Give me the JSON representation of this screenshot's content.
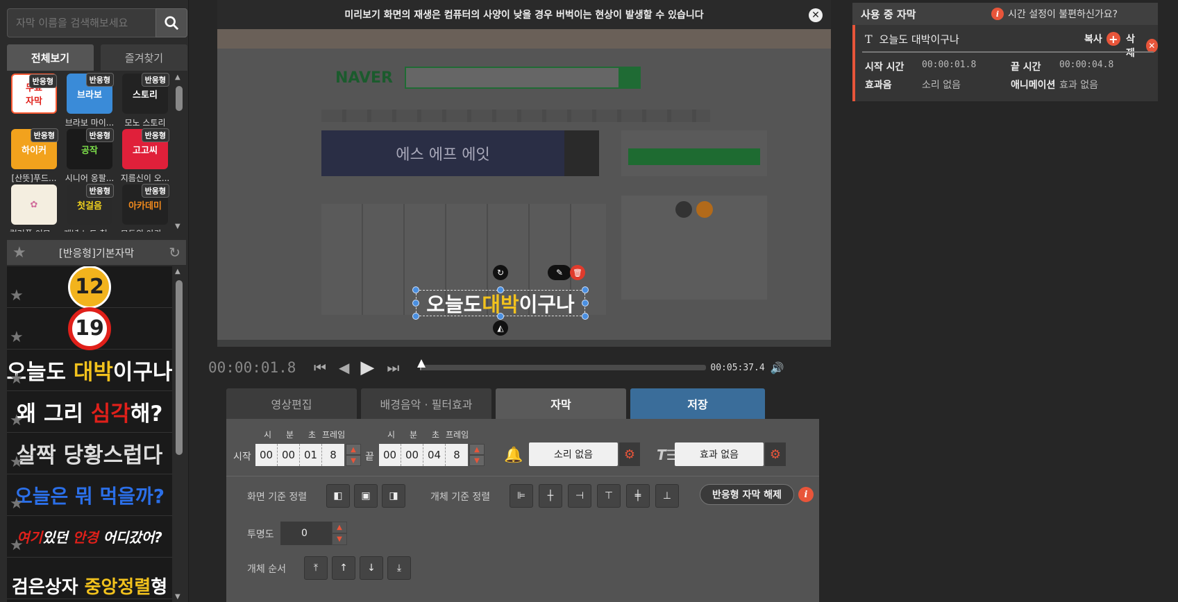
{
  "left": {
    "search_placeholder": "자막 이름을 검색해보세요",
    "tabs": [
      "전체보기",
      "즐겨찾기"
    ],
    "thumbs": [
      {
        "tag": "반응형",
        "caption": "",
        "art": "무료\n자막",
        "bg": "#ffffff",
        "fg": "#e0201a"
      },
      {
        "tag": "반응형",
        "caption": "브라보 마이...",
        "art": "브라보",
        "bg": "#3a8bd8",
        "fg": "#ffffff"
      },
      {
        "tag": "반응형",
        "caption": "모노 스토리",
        "art": "스토리",
        "bg": "#222222",
        "fg": "#ffffff"
      },
      {
        "tag": "반응형",
        "caption": "[산뜻]푸드...",
        "art": "하이커",
        "bg": "#f2a21d",
        "fg": "#ffffff"
      },
      {
        "tag": "반응형",
        "caption": "시니어 옹팔...",
        "art": "공작",
        "bg": "#1a1a1a",
        "fg": "#7de04a"
      },
      {
        "tag": "반응형",
        "caption": "지름신이 오...",
        "art": "고고씨",
        "bg": "#e0203a",
        "fg": "#ffffff"
      },
      {
        "tag": "",
        "caption": "컬러풀 이모...",
        "art": "✿",
        "bg": "#f4eee0",
        "fg": "#d06a9a"
      },
      {
        "tag": "반응형",
        "caption": "개념 노트 첫...",
        "art": "첫걸음",
        "bg": "#2a2a2a",
        "fg": "#f2d21d"
      },
      {
        "tag": "반응형",
        "caption": "모두의 아카...",
        "art": "아카데미",
        "bg": "#222222",
        "fg": "#f28a1d"
      }
    ],
    "section_title": "[반응형]기본자막",
    "presets": {
      "badge12": "12",
      "badge19": "19",
      "p1": {
        "a": "오늘도 ",
        "b": "대박",
        "c": "이구나"
      },
      "p2": {
        "a": "왜 그리 ",
        "b": "심각",
        "c": "해?"
      },
      "p3": "살짝 당황스럽다",
      "p4": "오늘은 뭐 먹을까?",
      "p5": {
        "a": "여기",
        "b": "있던 ",
        "c": "안경",
        "d": " 어디갔어?"
      },
      "p6": {
        "a": "검은상자 ",
        "b": "중앙정렬",
        "c": "형"
      }
    }
  },
  "preview": {
    "notice": "미리보기 화면의 재생은 컴퓨터의 사양이 낮을 경우 버벅이는 현상이 발생할 수 있습니다",
    "naver_logo": "NAVER",
    "banner_text": "에스 에프 에잇",
    "subtitle": {
      "a": "오늘도 ",
      "b": "대박",
      "c": "이구나"
    }
  },
  "player": {
    "current_time": "00:00:01.8",
    "total_time": "00:05:37.4",
    "progress": 0.005
  },
  "edit_tabs": [
    "영상편집",
    "배경음악 · 필터효과",
    "자막",
    "저장"
  ],
  "edit": {
    "start_label": "시작",
    "end_label": "끝",
    "units": [
      "시",
      "분",
      "초",
      "프레임"
    ],
    "start": [
      "00",
      "00",
      "01",
      "8"
    ],
    "end": [
      "00",
      "00",
      "04",
      "8"
    ],
    "sound": "소리 없음",
    "effect": "효과 없음",
    "screen_align_label": "화면 기준 정렬",
    "object_align_label": "개체 기준 정렬",
    "responsive_btn": "반응형 자막 해제",
    "opacity_label": "투명도",
    "opacity_value": "0",
    "order_label": "개체 순서"
  },
  "right": {
    "title": "사용 중 자막",
    "help": "시간 설정이 불편하신가요?",
    "item_title": "오늘도 대박이구나",
    "copy": "복사",
    "delete": "삭제",
    "start_key": "시작 시간",
    "start_val": "00:00:01.8",
    "end_key": "끝 시간",
    "end_val": "00:00:04.8",
    "sfx_key": "효과음",
    "sfx_val": "소리 없음",
    "anim_key": "애니메이션",
    "anim_val": "효과 없음"
  },
  "colors": {
    "accent": "#e8553a",
    "save_tab": "#3a6d9a",
    "highlight_yellow": "#f2c21d",
    "highlight_red": "#e0201a",
    "blue_text": "#2b6fe8"
  }
}
